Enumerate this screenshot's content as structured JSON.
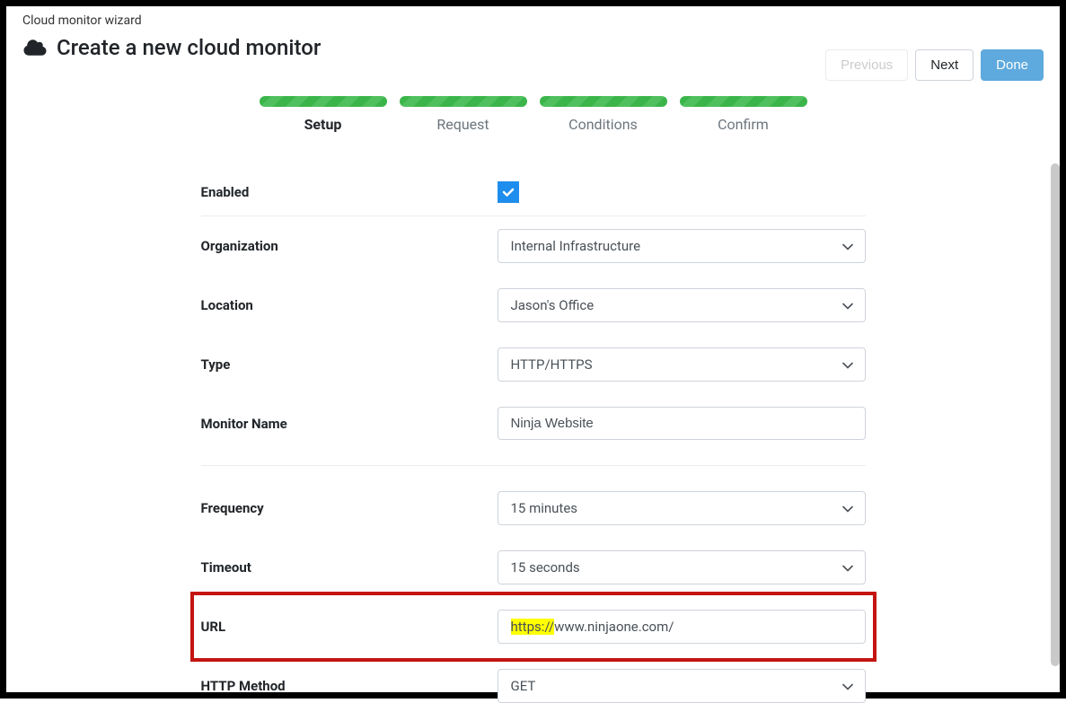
{
  "breadcrumb": "Cloud monitor wizard",
  "page_title": "Create a new cloud monitor",
  "buttons": {
    "previous": "Previous",
    "next": "Next",
    "done": "Done"
  },
  "steps": [
    {
      "label": "Setup",
      "active": true
    },
    {
      "label": "Request",
      "active": false
    },
    {
      "label": "Conditions",
      "active": false
    },
    {
      "label": "Confirm",
      "active": false
    }
  ],
  "form": {
    "enabled": {
      "label": "Enabled",
      "checked": true
    },
    "organization": {
      "label": "Organization",
      "value": "Internal Infrastructure"
    },
    "location": {
      "label": "Location",
      "value": "Jason's Office"
    },
    "type": {
      "label": "Type",
      "value": "HTTP/HTTPS"
    },
    "monitor_name": {
      "label": "Monitor Name",
      "value": "Ninja Website"
    },
    "frequency": {
      "label": "Frequency",
      "value": "15 minutes"
    },
    "timeout": {
      "label": "Timeout",
      "value": "15 seconds"
    },
    "url": {
      "label": "URL",
      "scheme": "https://",
      "host": "www.ninjaone.com/"
    },
    "http_method": {
      "label": "HTTP Method",
      "value": "GET"
    }
  }
}
